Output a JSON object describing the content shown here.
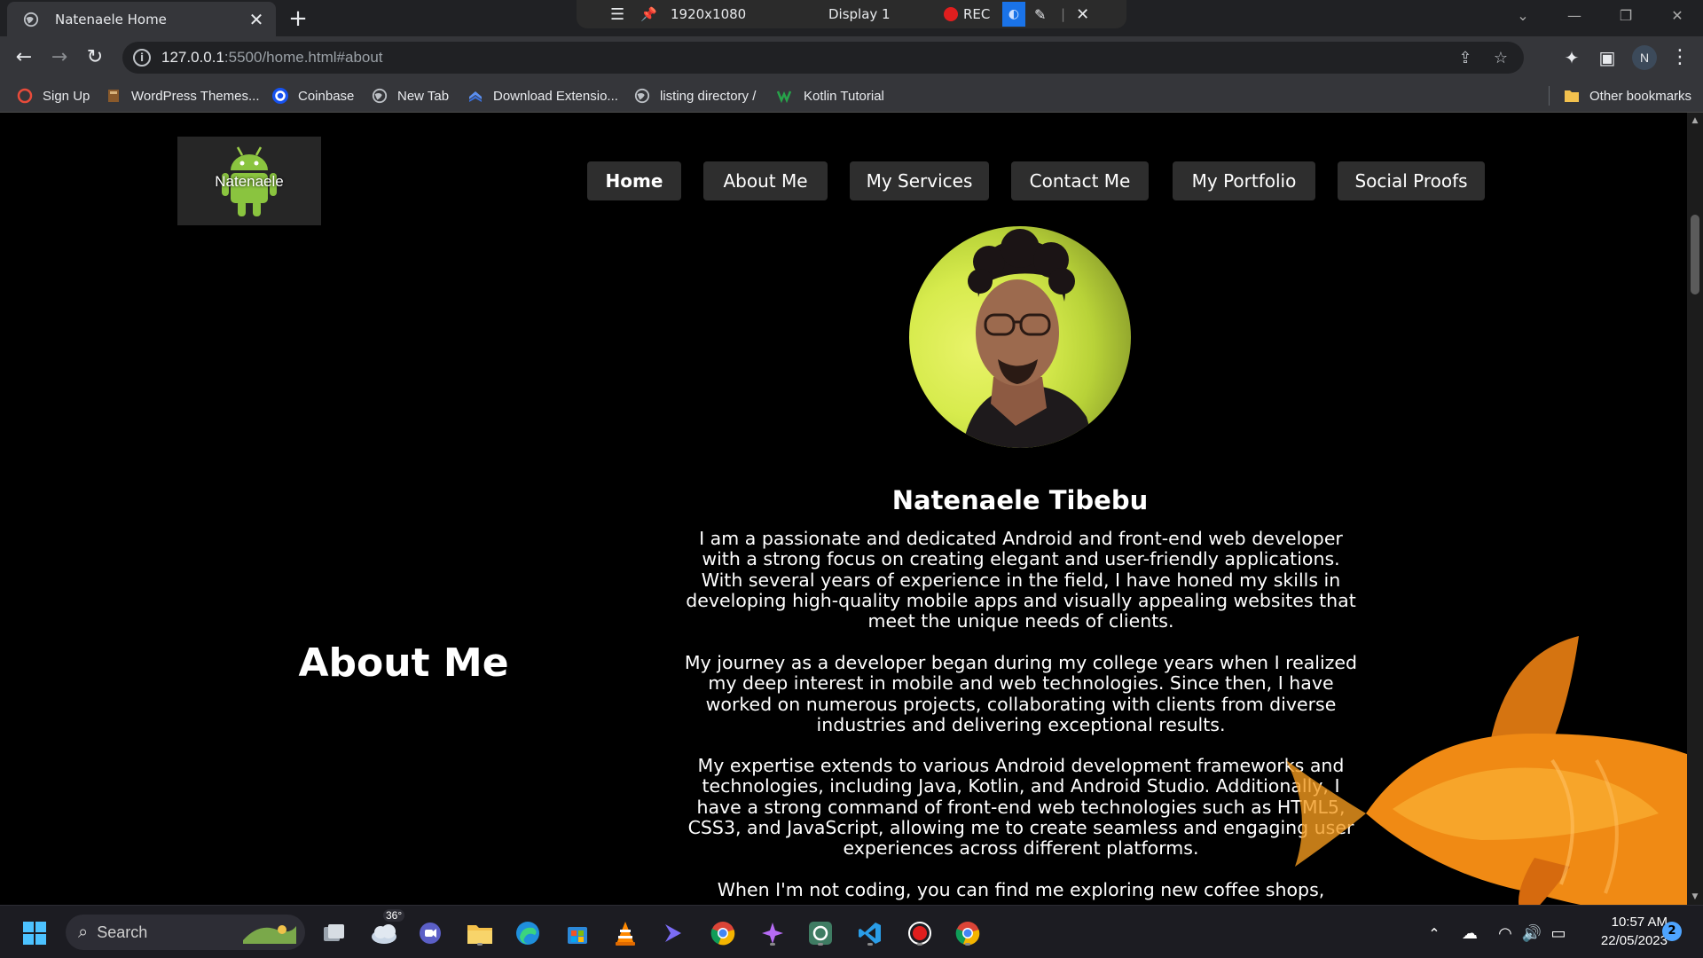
{
  "browser": {
    "tab": {
      "title": "Natenaele Home"
    },
    "recording_bar": {
      "resolution": "1920x1080",
      "display": "Display 1",
      "rec_label": "REC"
    },
    "address": {
      "host": "127.0.0.1",
      "path": ":5500/home.html#about"
    },
    "profile_initial": "N",
    "bookmarks": [
      {
        "label": "Sign Up"
      },
      {
        "label": "WordPress Themes..."
      },
      {
        "label": "Coinbase"
      },
      {
        "label": "New Tab"
      },
      {
        "label": "Download Extensio..."
      },
      {
        "label": "listing directory /"
      },
      {
        "label": "Kotlin Tutorial"
      }
    ],
    "other_bookmarks": "Other bookmarks"
  },
  "site": {
    "logo_text": "Natenaele",
    "nav": [
      {
        "label": "Home",
        "active": true
      },
      {
        "label": "About Me"
      },
      {
        "label": "My Services"
      },
      {
        "label": "Contact Me"
      },
      {
        "label": "My Portfolio"
      },
      {
        "label": "Social Proofs"
      }
    ],
    "name": "Natenaele Tibebu",
    "section_title": "About Me",
    "bio": [
      "I am a passionate and dedicated Android and front-end web developer with a strong focus on creating elegant and user-friendly applications. With several years of experience in the field, I have honed my skills in developing high-quality mobile apps and visually appealing websites that meet the unique needs of clients.",
      "My journey as a developer began during my college years when I realized my deep interest in mobile and web technologies. Since then, I have worked on numerous projects, collaborating with clients from diverse industries and delivering exceptional results.",
      "My expertise extends to various Android development frameworks and technologies, including Java, Kotlin, and Android Studio. Additionally, I have a strong command of front-end web technologies such as HTML5, CSS3, and JavaScript, allowing me to create seamless and engaging user experiences across different platforms.",
      "When I'm not coding, you can find me exploring new coffee shops,"
    ]
  },
  "taskbar": {
    "search_label": "Search",
    "weather_temp": "36°",
    "time": "10:57 AM",
    "date": "22/05/2023",
    "notification_count": "2"
  }
}
